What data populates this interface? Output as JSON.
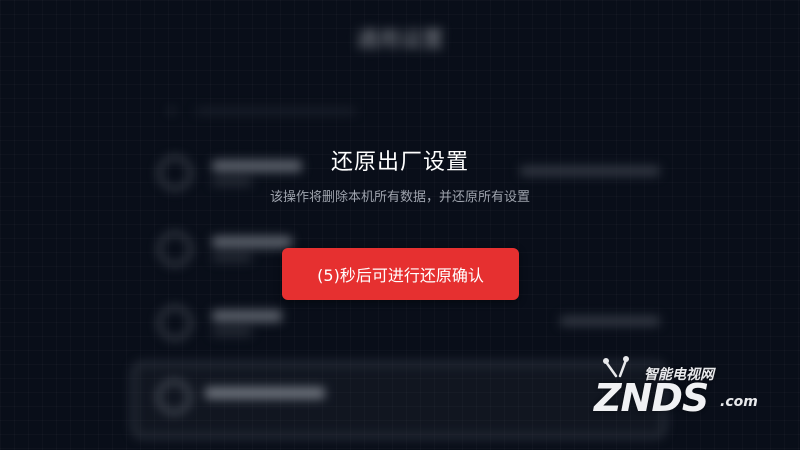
{
  "background": {
    "title": "通用设置"
  },
  "dialog": {
    "title": "还原出厂设置",
    "description": "该操作将删除本机所有数据，并还原所有设置",
    "confirm_label": "(5)秒后可进行还原确认"
  },
  "watermark": {
    "tagline": "智能电视网",
    "brand": "ZNDS",
    "suffix": ".com"
  },
  "colors": {
    "accent": "#e63030",
    "background": "#0d121e"
  }
}
